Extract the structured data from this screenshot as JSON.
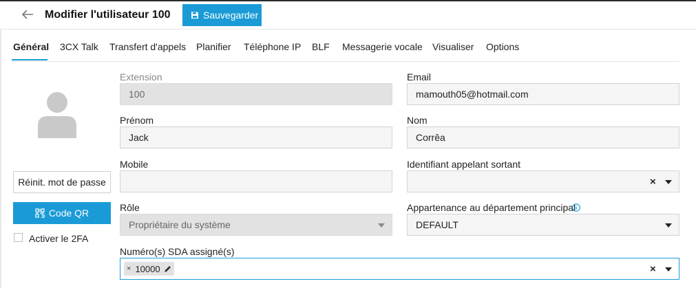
{
  "header": {
    "title": "Modifier l'utilisateur 100",
    "save_label": "Sauvegarder"
  },
  "tabs": [
    {
      "label": "Général",
      "active": true
    },
    {
      "label": "3CX Talk"
    },
    {
      "label": "Transfert d'appels"
    },
    {
      "label": "Planifier"
    },
    {
      "label": "Téléphone IP"
    },
    {
      "label": "BLF"
    },
    {
      "label": "Messagerie vocale"
    },
    {
      "label": "Visualiser"
    },
    {
      "label": "Options"
    }
  ],
  "left_panel": {
    "reset_password_label": "Réinit. mot de passe",
    "qr_code_label": "Code QR",
    "enable_2fa_label": "Activer le 2FA",
    "enable_2fa_checked": false
  },
  "form": {
    "extension": {
      "label": "Extension",
      "value": "100"
    },
    "email": {
      "label": "Email",
      "value": "mamouth05@hotmail.com"
    },
    "first_name": {
      "label": "Prénom",
      "value": "Jack"
    },
    "last_name": {
      "label": "Nom",
      "value": "Corrêa"
    },
    "mobile": {
      "label": "Mobile",
      "value": ""
    },
    "outbound_caller_id": {
      "label": "Identifiant appelant sortant",
      "value": ""
    },
    "role": {
      "label": "Rôle",
      "value": "Propriétaire du système"
    },
    "department": {
      "label": "Appartenance au département principal",
      "value": "DEFAULT"
    },
    "did_numbers": {
      "label": "Numéro(s) SDA assigné(s)",
      "chips": [
        "10000"
      ]
    }
  },
  "colors": {
    "accent": "#1a9bd7",
    "disabled_field": "#e2e2e2",
    "field_bg": "#f5f5f5"
  },
  "icons": [
    "back-arrow-icon",
    "save-icon",
    "avatar-icon",
    "qr-code-icon",
    "info-icon",
    "pencil-icon",
    "close-icon",
    "chevron-down-icon"
  ]
}
